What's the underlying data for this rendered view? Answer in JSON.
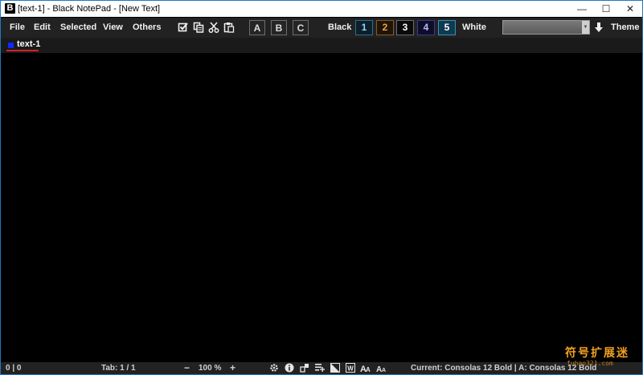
{
  "window": {
    "app_icon_letter": "B",
    "title": "[text-1] - Black NotePad - [New Text]",
    "minimize_glyph": "—",
    "maximize_glyph": "☐",
    "close_glyph": "✕"
  },
  "menu": {
    "file": "File",
    "edit": "Edit",
    "selected": "Selected",
    "view": "View",
    "others": "Others"
  },
  "toolbar_icons": [
    "checkbox-icon",
    "copy-icon",
    "cut-icon",
    "paste-icon"
  ],
  "letter_buttons": [
    "A",
    "B",
    "C"
  ],
  "theme_bar": {
    "black_label": "Black",
    "white_label": "White",
    "theme_label": "Theme",
    "numbers": [
      {
        "label": "1",
        "fg": "#8fd3ff",
        "border": "#2a6f8f",
        "bg": "#0d1f28"
      },
      {
        "label": "2",
        "fg": "#e8a24a",
        "border": "#8a5a1d",
        "bg": "#1f140a"
      },
      {
        "label": "3",
        "fg": "#ffffff",
        "border": "#6a6a6a",
        "bg": "#0a0a0a"
      },
      {
        "label": "4",
        "fg": "#b9b9ff",
        "border": "#3b3b8a",
        "bg": "#0e0e2a"
      },
      {
        "label": "5",
        "fg": "#ffffff",
        "border": "#3a90b0",
        "bg": "#0f3a50"
      }
    ],
    "combo_value": "",
    "download_icon": "down-arrow-icon"
  },
  "tabs": [
    {
      "label": "text-1",
      "indicator_color": "#1028ff"
    }
  ],
  "status": {
    "position": "0 | 0",
    "tab": "Tab: 1 / 1",
    "zoom_minus": "−",
    "zoom": "100 %",
    "zoom_plus": "+",
    "current_font": "Current: Consolas 12 Bold | A: Consolas 12 Bold"
  },
  "watermark": {
    "text": "符号扩展迷",
    "sub": "fuhao321.com"
  },
  "colors": {
    "accent_border": "#1e79c7",
    "editor_bg": "#000000",
    "toolbar_bg": "#222222",
    "tab_underline": "#d22222"
  }
}
